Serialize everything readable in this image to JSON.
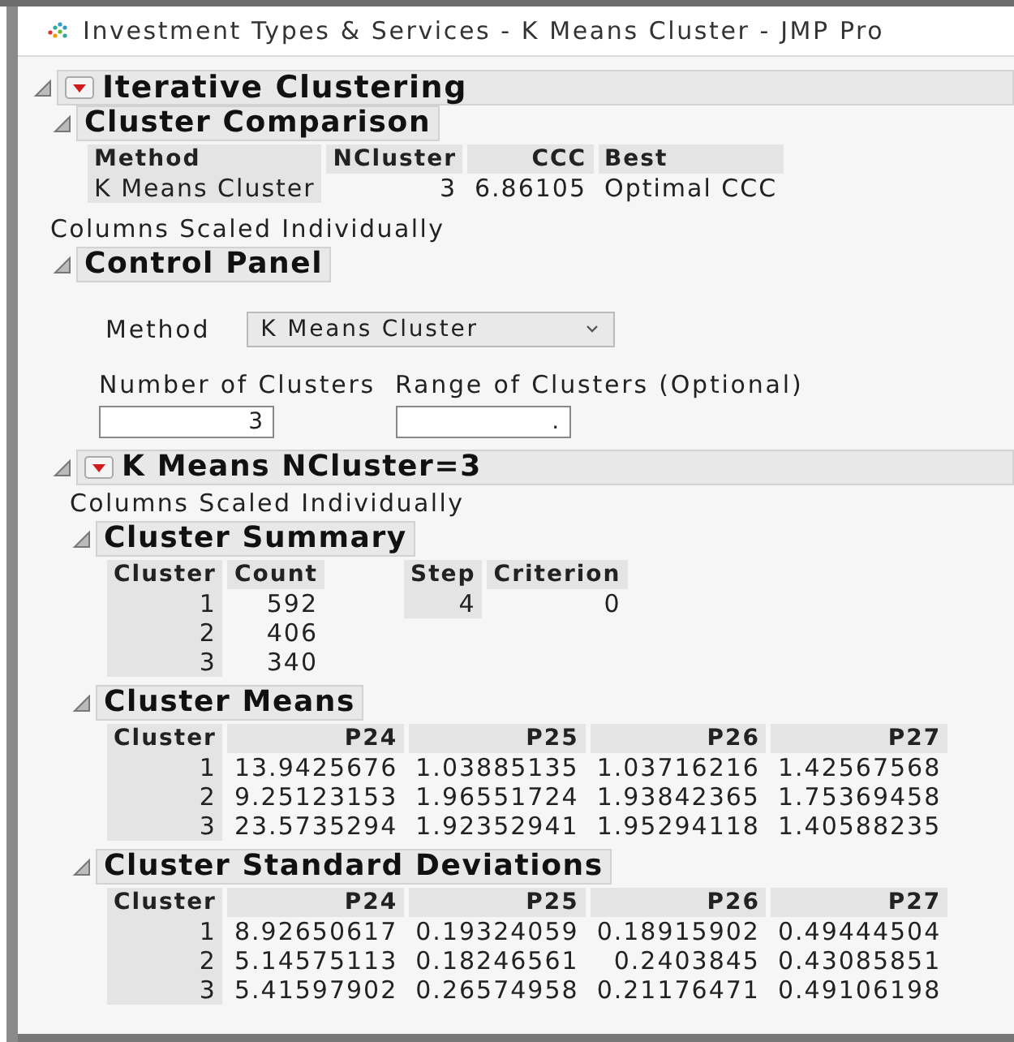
{
  "window": {
    "title": "Investment Types & Services - K Means Cluster - JMP Pro"
  },
  "report": {
    "title": "Iterative Clustering",
    "expanded": true,
    "menu": true,
    "sections": [
      {
        "kind": "tables",
        "title": "Cluster Comparison",
        "expanded": true,
        "menu": false,
        "tables": [
          {
            "columns": [
              "Method",
              "NCluster",
              "CCC",
              "Best"
            ],
            "rows": [
              [
                "K Means Cluster",
                "3",
                "6.86105",
                "Optimal CCC"
              ]
            ]
          }
        ]
      },
      {
        "kind": "note",
        "text": "Columns Scaled Individually"
      },
      {
        "kind": "control_panel",
        "title": "Control Panel",
        "expanded": true,
        "menu": false,
        "method_label": "Method",
        "method_value": "K Means Cluster",
        "fields": [
          {
            "label": "Number of Clusters",
            "value": "3"
          },
          {
            "label": "Range of Clusters (Optional)",
            "value": "."
          }
        ]
      },
      {
        "kind": "group",
        "title": "K Means NCluster=3",
        "expanded": true,
        "menu": true,
        "sections": [
          {
            "kind": "note",
            "text": "Columns Scaled Individually"
          },
          {
            "kind": "tables",
            "title": "Cluster Summary",
            "expanded": true,
            "menu": false,
            "tables": [
              {
                "columns": [
                  "Cluster",
                  "Count"
                ],
                "rows": [
                  [
                    "1",
                    "592"
                  ],
                  [
                    "2",
                    "406"
                  ],
                  [
                    "3",
                    "340"
                  ]
                ]
              },
              {
                "columns": [
                  "Step",
                  "Criterion"
                ],
                "rows": [
                  [
                    "4",
                    "0"
                  ]
                ]
              }
            ]
          },
          {
            "kind": "tables",
            "title": "Cluster Means",
            "expanded": true,
            "menu": false,
            "tables": [
              {
                "columns": [
                  "Cluster",
                  "P24",
                  "P25",
                  "P26",
                  "P27"
                ],
                "rows": [
                  [
                    "1",
                    "13.9425676",
                    "1.03885135",
                    "1.03716216",
                    "1.42567568"
                  ],
                  [
                    "2",
                    "9.25123153",
                    "1.96551724",
                    "1.93842365",
                    "1.75369458"
                  ],
                  [
                    "3",
                    "23.5735294",
                    "1.92352941",
                    "1.95294118",
                    "1.40588235"
                  ]
                ]
              }
            ]
          },
          {
            "kind": "tables",
            "title": "Cluster Standard Deviations",
            "expanded": true,
            "menu": false,
            "tables": [
              {
                "columns": [
                  "Cluster",
                  "P24",
                  "P25",
                  "P26",
                  "P27"
                ],
                "rows": [
                  [
                    "1",
                    "8.92650617",
                    "0.19324059",
                    "0.18915902",
                    "0.49444504"
                  ],
                  [
                    "2",
                    "5.14575113",
                    "0.18246561",
                    "0.2403845",
                    "0.43085851"
                  ],
                  [
                    "3",
                    "5.41597902",
                    "0.26574958",
                    "0.21176471",
                    "0.49106198"
                  ]
                ]
              }
            ]
          }
        ]
      }
    ]
  }
}
